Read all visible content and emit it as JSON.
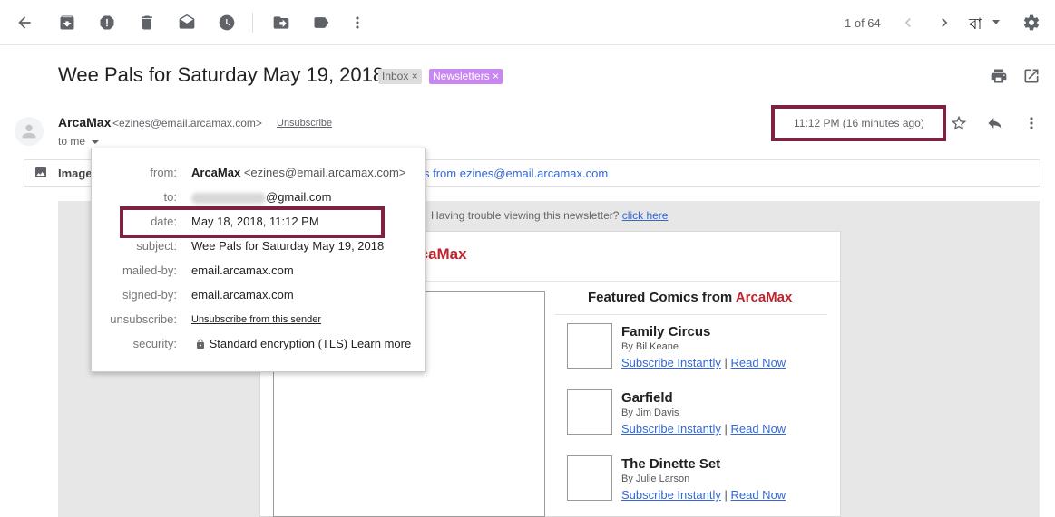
{
  "toolbar": {
    "icons": [
      "back-icon",
      "archive-icon",
      "report-spam-icon",
      "delete-icon",
      "mark-unread-icon",
      "snooze-icon",
      "move-to-icon",
      "label-icon",
      "more-vert-icon"
    ],
    "count": "1 of 64",
    "input_tool": "বা"
  },
  "email": {
    "subject": "Wee Pals for Saturday May 19, 2018",
    "labels": [
      {
        "name": "Inbox",
        "close": "×"
      },
      {
        "name": "Newsletters",
        "close": "×",
        "color": "#c987f1"
      }
    ],
    "sender_name": "ArcaMax",
    "sender_email": "<ezines@email.arcamax.com>",
    "unsubscribe": "Unsubscribe",
    "to_me": "to me",
    "time": "11:12 PM (16 minutes ago)"
  },
  "images_bar": {
    "text": "Image",
    "link": "s from ezines@email.arcamax.com"
  },
  "newsletter": {
    "trouble_text": "Having trouble viewing this newsletter?",
    "trouble_link": "click here",
    "logo_text": "rcaMax",
    "featured_prefix": "Featured Comics from ",
    "featured_brand": "ArcaMax",
    "comics": [
      {
        "title": "Family Circus",
        "by": "By Bil Keane",
        "subscribe": "Subscribe Instantly",
        "sep": "|",
        "read": "Read Now"
      },
      {
        "title": "Garfield",
        "by": "By Jim Davis",
        "subscribe": "Subscribe Instantly",
        "sep": "|",
        "read": "Read Now"
      },
      {
        "title": "The Dinette Set",
        "by": "By Julie Larson",
        "subscribe": "Subscribe Instantly",
        "sep": "|",
        "read": "Read Now"
      }
    ]
  },
  "popup": {
    "from_label": "from:",
    "from_name": "ArcaMax",
    "from_email": "<ezines@email.arcamax.com>",
    "to_label": "to:",
    "to_suffix": "@gmail.com",
    "date_label": "date:",
    "date_value": "May 18, 2018, 11:12 PM",
    "subject_label": "subject:",
    "subject_value": "Wee Pals for Saturday May 19, 2018",
    "mailed_by_label": "mailed-by:",
    "mailed_by_value": "email.arcamax.com",
    "signed_by_label": "signed-by:",
    "signed_by_value": "email.arcamax.com",
    "unsubscribe_label": "unsubscribe:",
    "unsubscribe_value": "Unsubscribe from this sender",
    "security_label": "security:",
    "security_value": "Standard encryption (TLS)",
    "learn_more": "Learn more"
  },
  "colors": {
    "highlight_box": "#7e2240",
    "brand_red": "#c0232c",
    "link_blue": "#3367d6",
    "newsletters_label": "#c987f1"
  }
}
